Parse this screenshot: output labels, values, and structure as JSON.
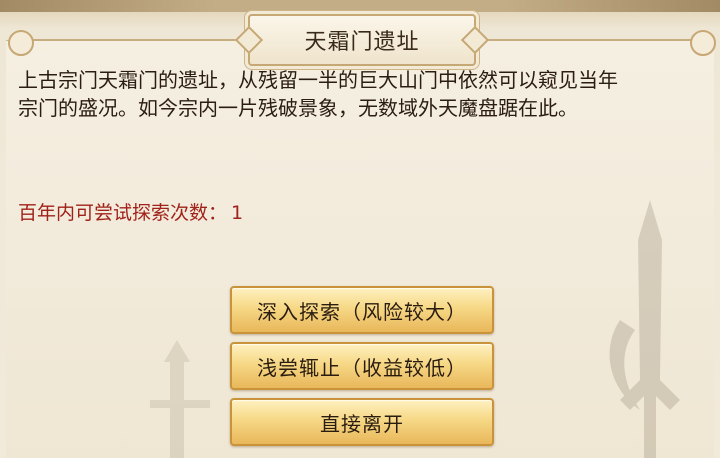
{
  "dialog": {
    "title": "天霜门遗址",
    "description_line1": "上古宗门天霜门的遗址，从残留一半的巨大山门中依然可以窥见当年",
    "description_line2": "宗门的盛况。如今宗内一片残破景象，无数域外天魔盘踞在此。",
    "attempts_label": "百年内可尝试探索次数：",
    "attempts_count": "1"
  },
  "buttons": {
    "deep_explore": "深入探索（风险较大）",
    "shallow_stop": "浅尝辄止（收益较低）",
    "leave": "直接离开"
  },
  "colors": {
    "attempts_text": "#a1221a",
    "button_gold": "#f6d886",
    "panel_bg": "#f1eadb"
  }
}
